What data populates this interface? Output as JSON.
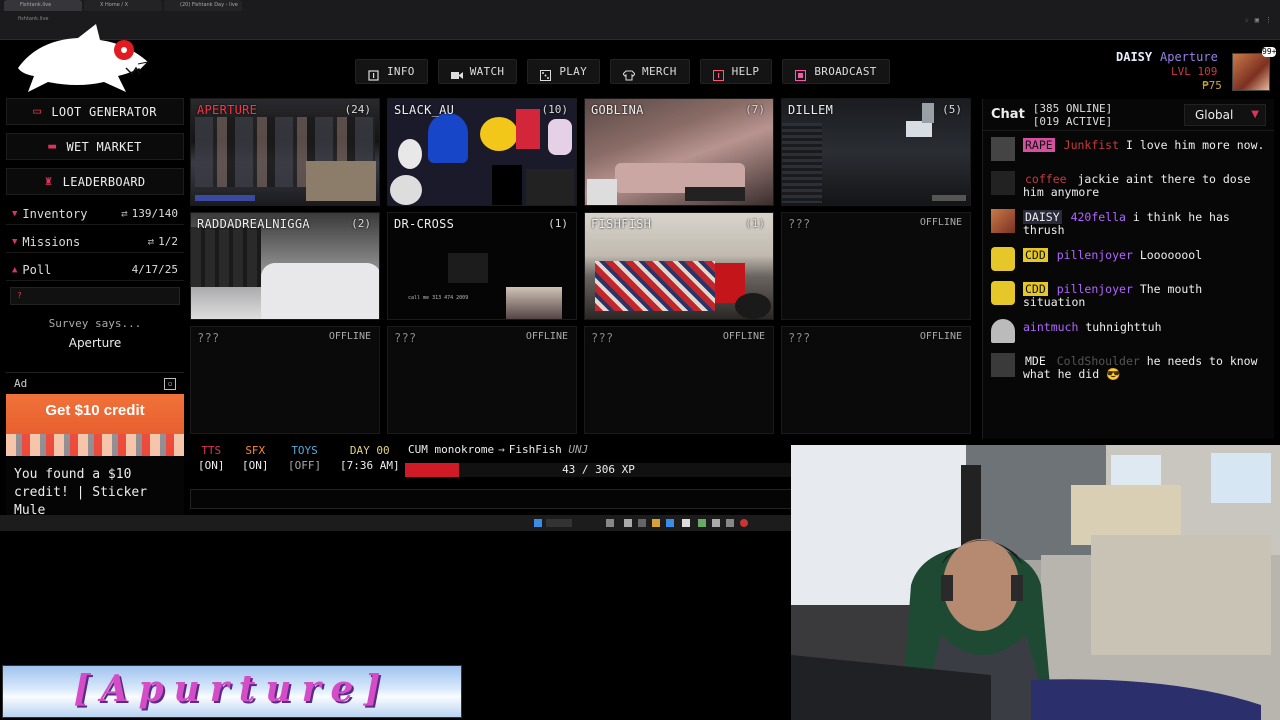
{
  "browser": {
    "tabs": [
      "Fishtank.live",
      "X Home / X",
      "(20) Fishtank Day - live"
    ],
    "url": "fishtank.live"
  },
  "nav": [
    {
      "label": "INFO",
      "icon": "info-icon"
    },
    {
      "label": "WATCH",
      "icon": "camera-icon"
    },
    {
      "label": "PLAY",
      "icon": "dice-icon"
    },
    {
      "label": "MERCH",
      "icon": "shirt-icon"
    },
    {
      "label": "HELP",
      "icon": "help-icon"
    },
    {
      "label": "BROADCAST",
      "icon": "broadcast-icon"
    }
  ],
  "profile": {
    "name": "DAISY",
    "tag": "Aperture",
    "level": "LVL 109",
    "money": "₱75",
    "notifications": "99+"
  },
  "sidebar": {
    "loot": "LOOT GENERATOR",
    "market": "WET MARKET",
    "leaderboard": "LEADERBOARD",
    "inventory": {
      "label": "Inventory",
      "count": "139/140"
    },
    "missions": {
      "label": "Missions",
      "count": "1/2"
    },
    "poll": {
      "label": "Poll",
      "date": "4/17/25",
      "survey": "Survey says...",
      "answer": "Aperture"
    },
    "ad": {
      "label": "Ad",
      "banner": "Get $10 credit",
      "text": "You found a $10 credit! | Sticker Mule"
    }
  },
  "cameras": [
    {
      "name": "APERTURE",
      "count": "(24)",
      "live": true,
      "red": true
    },
    {
      "name": "SLACK_AU",
      "count": "(10)",
      "live": true
    },
    {
      "name": "GOBLINA",
      "count": "(7)",
      "live": true
    },
    {
      "name": "DILLEM",
      "count": "(5)",
      "live": true
    },
    {
      "name": "RADDADREALNIGGA",
      "count": "(2)",
      "live": true
    },
    {
      "name": "DR-CROSS",
      "count": "(1)",
      "live": true
    },
    {
      "name": "FISHFISH",
      "count": "(1)",
      "live": true
    },
    {
      "name": "???",
      "count": "OFFLINE",
      "live": false
    },
    {
      "name": "???",
      "count": "OFFLINE",
      "live": false
    },
    {
      "name": "???",
      "count": "OFFLINE",
      "live": false
    },
    {
      "name": "???",
      "count": "OFFLINE",
      "live": false
    },
    {
      "name": "???",
      "count": "OFFLINE",
      "live": false
    }
  ],
  "chat": {
    "title": "Chat",
    "online": "[385 ONLINE]",
    "active": "[019 ACTIVE]",
    "room": "Global",
    "messages": [
      {
        "user": "RAPE",
        "style": "u-rape",
        "extra": "Junkfist",
        "extraStyle": "u-faded",
        "text": "I love him more now."
      },
      {
        "user": "coffee",
        "style": "u-faded",
        "extra": "",
        "extraStyle": "",
        "text": "jackie aint there to dose him anymore"
      },
      {
        "user": "DAISY",
        "style": "u-daisy",
        "extra": "420fella",
        "extraStyle": "u-link",
        "text": "i think he has thrush"
      },
      {
        "user": "CDD",
        "style": "u-cdd",
        "extra": "pillenjoyer",
        "extraStyle": "u-link",
        "text": "Loooooool"
      },
      {
        "user": "CDD",
        "style": "u-cdd",
        "extra": "pillenjoyer",
        "extraStyle": "u-link",
        "text": "The mouth situation"
      },
      {
        "user": "aintmuch",
        "style": "u-link",
        "extra": "",
        "extraStyle": "",
        "text": "tuhnighttuh"
      },
      {
        "user": "MDE",
        "style": "u-mde",
        "extra": "ColdShoulder",
        "extraStyle": "u-faded2",
        "text": "he needs to know what he did 😎"
      }
    ]
  },
  "hud": {
    "tts": {
      "label": "TTS",
      "state": "[ON]"
    },
    "sfx": {
      "label": "SFX",
      "state": "[ON]"
    },
    "toys": {
      "label": "TOYS",
      "state": "[OFF]"
    },
    "day": {
      "label": "DAY 00",
      "time": "[7:36 AM]"
    },
    "ticker": {
      "from": "CUM monokrome",
      "arrow": "→",
      "to": "FishFish",
      "tag": "UNJ"
    },
    "xp": {
      "text": "43 / 306 XP",
      "fraction": 0.1405
    }
  },
  "banner": {
    "text": "[Apurture]"
  },
  "colors": {
    "accent": "#e0335a",
    "background": "#000000",
    "xp": "#d01a25"
  }
}
